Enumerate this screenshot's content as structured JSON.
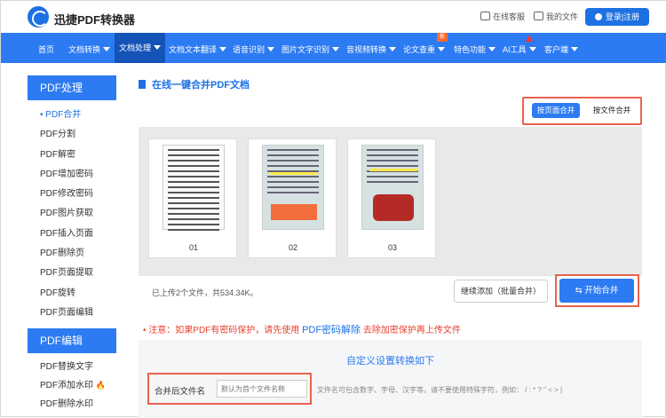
{
  "header": {
    "brand": "迅捷PDF转换器",
    "service": "在线客服",
    "my_files": "我的文件",
    "login": "登录|注册"
  },
  "nav": {
    "items": [
      "首页",
      "文档转换",
      "文档处理",
      "文档文本翻译",
      "语音识别",
      "图片文字识别",
      "音视频转换",
      "论文查重",
      "特色功能",
      "AI工具",
      "客户端"
    ],
    "badge": "新"
  },
  "sidebar": {
    "section1": "PDF处理",
    "items1": [
      "PDF合并",
      "PDF分割",
      "PDF解密",
      "PDF增加密码",
      "PDF修改密码",
      "PDF图片获取",
      "PDF插入页面",
      "PDF删除页",
      "PDF页面提取",
      "PDF旋转",
      "PDF页面编辑"
    ],
    "section2": "PDF编辑",
    "items2": [
      "PDF替换文字",
      "PDF添加水印",
      "PDF删除水印"
    ]
  },
  "main": {
    "title": "在线一键合并PDF文档",
    "mode_page": "按页面合并",
    "mode_file": "按文件合并",
    "cards": [
      "01",
      "02",
      "03"
    ],
    "uploaded": "已上传2个文件，共534.34K。",
    "add_btn": "继续添加（批量合并）",
    "start_btn": "开始合并",
    "notice_a": "注意：如果PDF有密码保护，请先使用",
    "notice_link": "PDF密码解除",
    "notice_b": "去除加密保护再上传文件",
    "cfg_title": "自定义设置转换如下",
    "name_label": "合并后文件名",
    "name_placeholder": "默认为首个文件名称",
    "name_hint": "文件名可包含数字、字母、汉字等。请不要使用特殊字符，例如： / : * ? \" < > |"
  },
  "colors": {
    "primary": "#2d7bf2",
    "highlight": "#e8624e"
  }
}
